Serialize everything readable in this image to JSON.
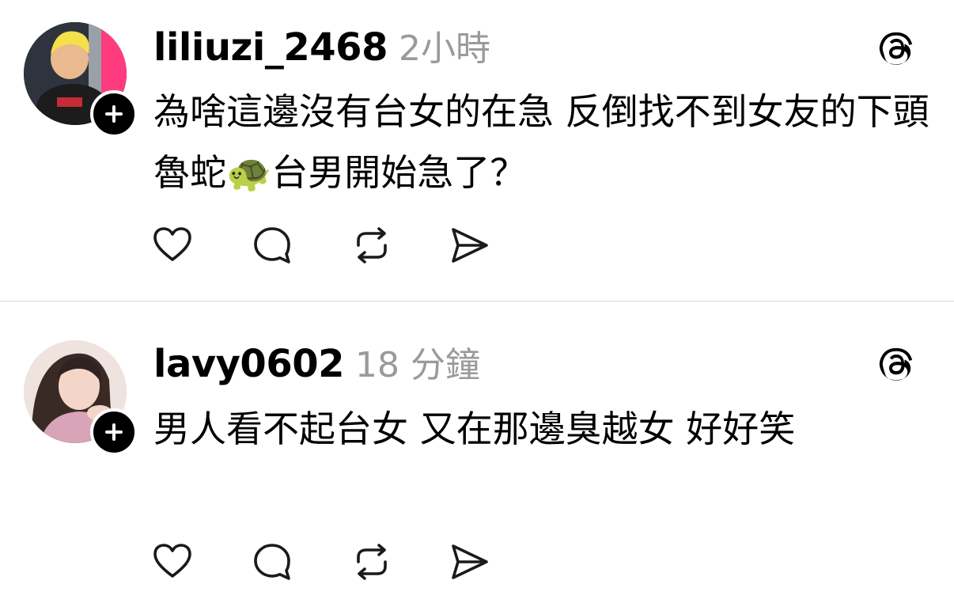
{
  "posts": [
    {
      "username": "liliuzi_2468",
      "time": "2小時",
      "text": "為啥這邊沒有台女的在急 反倒找不到女友的下頭魯蛇🐢台男開始急了？",
      "avatar_icon": "user-avatar-photo",
      "follow_icon": "plus-icon",
      "menu_icon": "threads-icon"
    },
    {
      "username": "lavy0602",
      "time": "18 分鐘",
      "text": "男人看不起台女 又在那邊臭越女 好好笑",
      "avatar_icon": "user-avatar-photo",
      "follow_icon": "plus-icon",
      "menu_icon": "threads-icon"
    }
  ],
  "action_icons": [
    "heart-icon",
    "comment-icon",
    "repost-icon",
    "share-icon"
  ],
  "colors": {
    "text": "#000000",
    "muted": "#9a9a9a",
    "divider": "#dcdcdc",
    "background": "#ffffff"
  }
}
